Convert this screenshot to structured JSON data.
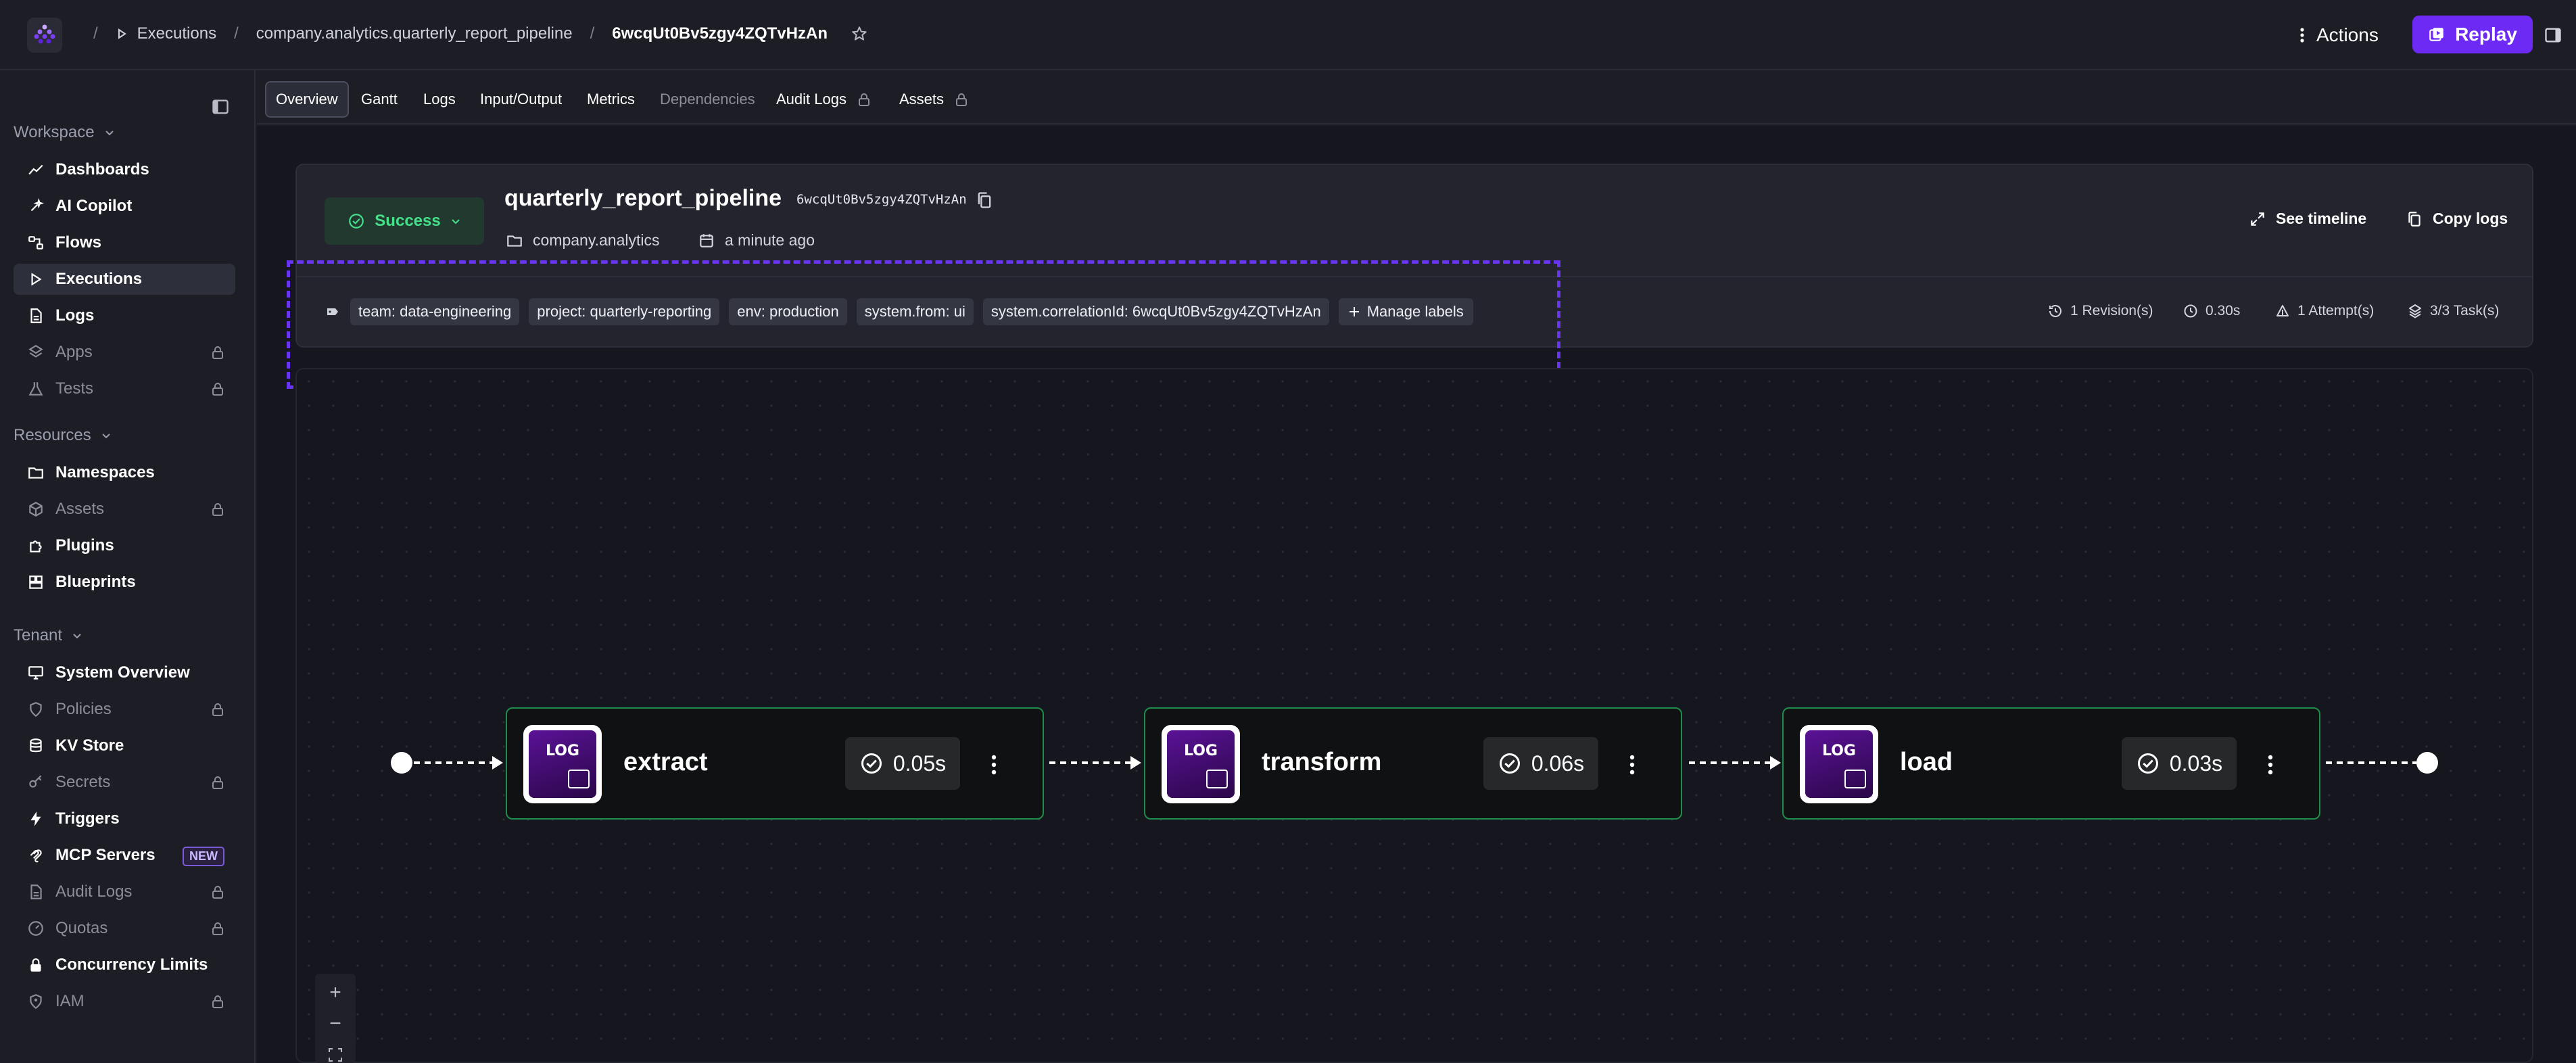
{
  "topbar": {
    "crumbs": [
      {
        "label": "Executions"
      },
      {
        "label": "company.analytics.quarterly_report_pipeline"
      },
      {
        "label": "6wcqUt0Bv5zgy4ZQTvHzAn"
      }
    ],
    "actions_label": "Actions",
    "replay_label": "Replay",
    "icons": {
      "logo": "kestra-logo-icon",
      "play": "play-icon",
      "star": "star-icon",
      "kebab": "kebab-icon",
      "replay": "replay-icon",
      "panel": "panel-toggle-icon"
    }
  },
  "sidebar": {
    "sections": [
      {
        "title": "Workspace",
        "items": [
          {
            "label": "Dashboards",
            "icon": "chart-line-icon",
            "locked": false
          },
          {
            "label": "AI Copilot",
            "icon": "sparkle-icon",
            "locked": false
          },
          {
            "label": "Flows",
            "icon": "flow-icon",
            "locked": false
          },
          {
            "label": "Executions",
            "icon": "play-icon",
            "locked": false,
            "active": true
          },
          {
            "label": "Logs",
            "icon": "file-icon",
            "locked": false
          },
          {
            "label": "Apps",
            "icon": "layers-icon",
            "locked": true
          },
          {
            "label": "Tests",
            "icon": "flask-icon",
            "locked": true
          }
        ]
      },
      {
        "title": "Resources",
        "items": [
          {
            "label": "Namespaces",
            "icon": "folder-icon",
            "locked": false
          },
          {
            "label": "Assets",
            "icon": "cube-icon",
            "locked": true
          },
          {
            "label": "Plugins",
            "icon": "puzzle-icon",
            "locked": false
          },
          {
            "label": "Blueprints",
            "icon": "blueprint-icon",
            "locked": false
          }
        ]
      },
      {
        "title": "Tenant",
        "items": [
          {
            "label": "System Overview",
            "icon": "monitor-icon",
            "locked": false
          },
          {
            "label": "Policies",
            "icon": "shield-icon",
            "locked": true
          },
          {
            "label": "KV Store",
            "icon": "database-icon",
            "locked": false
          },
          {
            "label": "Secrets",
            "icon": "key-icon",
            "locked": true
          },
          {
            "label": "Triggers",
            "icon": "bolt-icon",
            "locked": false
          },
          {
            "label": "MCP Servers",
            "icon": "mcp-icon",
            "locked": false,
            "badge": "NEW"
          },
          {
            "label": "Audit Logs",
            "icon": "file-icon",
            "locked": true
          },
          {
            "label": "Quotas",
            "icon": "gauge-icon",
            "locked": true
          },
          {
            "label": "Concurrency Limits",
            "icon": "lock-icon",
            "locked": false
          },
          {
            "label": "IAM",
            "icon": "user-shield-icon",
            "locked": true
          }
        ]
      }
    ]
  },
  "tabs": [
    {
      "label": "Overview",
      "active": true
    },
    {
      "label": "Gantt"
    },
    {
      "label": "Logs"
    },
    {
      "label": "Input/Output"
    },
    {
      "label": "Metrics"
    },
    {
      "label": "Dependencies",
      "disabled": true
    },
    {
      "label": "Audit Logs",
      "locked": true
    },
    {
      "label": "Assets",
      "locked": true
    }
  ],
  "execution": {
    "status": "Success",
    "flow": "quarterly_report_pipeline",
    "id": "6wcqUt0Bv5zgy4ZQTvHzAn",
    "namespace": "company.analytics",
    "time_ago": "a minute ago",
    "see_timeline": "See timeline",
    "copy_logs": "Copy logs",
    "labels": [
      "team: data-engineering",
      "project: quarterly-reporting",
      "env: production",
      "system.from: ui",
      "system.correlationId: 6wcqUt0Bv5zgy4ZQTvHzAn"
    ],
    "manage_labels": "Manage labels",
    "stats": {
      "revisions": "1 Revision(s)",
      "duration": "0.30s",
      "attempts": "1 Attempt(s)",
      "tasks": "3/3 Task(s)"
    }
  },
  "topology": {
    "nodes": [
      {
        "name": "extract",
        "icon_text": "LOG",
        "duration": "0.05s"
      },
      {
        "name": "transform",
        "icon_text": "LOG",
        "duration": "0.06s"
      },
      {
        "name": "load",
        "icon_text": "LOG",
        "duration": "0.03s"
      }
    ],
    "zoom": {
      "in": "+",
      "out": "−"
    }
  },
  "colors": {
    "accent": "#6d2af5",
    "success": "#44e08a",
    "node_border": "#1f8c4c"
  }
}
